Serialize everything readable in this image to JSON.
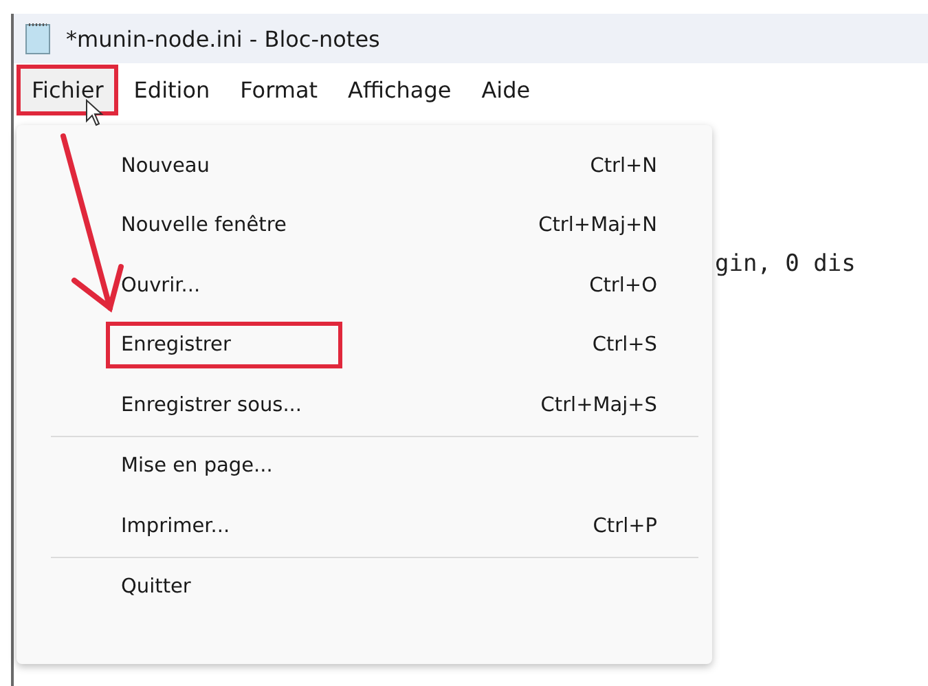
{
  "window": {
    "title": "*munin-node.ini - Bloc-notes"
  },
  "menu_bar": [
    {
      "label": "Fichier",
      "selected": true,
      "highlighted": true
    },
    {
      "label": "Edition",
      "selected": false,
      "highlighted": false
    },
    {
      "label": "Format",
      "selected": false,
      "highlighted": false
    },
    {
      "label": "Affichage",
      "selected": false,
      "highlighted": false
    },
    {
      "label": "Aide",
      "selected": false,
      "highlighted": false
    }
  ],
  "editor": {
    "visible_text": "gin, 0 dis"
  },
  "menu": {
    "items": [
      {
        "kind": "item",
        "label": "Nouveau",
        "shortcut": "Ctrl+N",
        "highlighted": false
      },
      {
        "kind": "item",
        "label": "Nouvelle fenêtre",
        "shortcut": "Ctrl+Maj+N",
        "highlighted": false
      },
      {
        "kind": "item",
        "label": "Ouvrir...",
        "shortcut": "Ctrl+O",
        "highlighted": false
      },
      {
        "kind": "item",
        "label": "Enregistrer",
        "shortcut": "Ctrl+S",
        "highlighted": true
      },
      {
        "kind": "item",
        "label": "Enregistrer sous...",
        "shortcut": "Ctrl+Maj+S",
        "highlighted": false
      },
      {
        "kind": "separator"
      },
      {
        "kind": "item",
        "label": "Mise en page...",
        "highlighted": false
      },
      {
        "kind": "item",
        "label": "Imprimer...",
        "shortcut": "Ctrl+P",
        "highlighted": false
      },
      {
        "kind": "separator"
      },
      {
        "kind": "item",
        "label": "Quitter",
        "highlighted": false
      }
    ]
  }
}
